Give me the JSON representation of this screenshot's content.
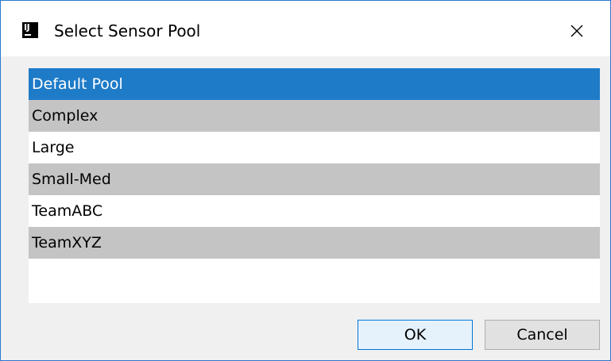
{
  "window": {
    "title": "Select Sensor Pool",
    "icon": "intellij-icon",
    "app_icon_text": "IJ"
  },
  "list": {
    "items": [
      {
        "label": "Default Pool",
        "selected": true
      },
      {
        "label": "Complex",
        "selected": false
      },
      {
        "label": "Large",
        "selected": false
      },
      {
        "label": "Small-Med",
        "selected": false
      },
      {
        "label": "TeamABC",
        "selected": false
      },
      {
        "label": "TeamXYZ",
        "selected": false
      }
    ]
  },
  "buttons": {
    "ok_label": "OK",
    "cancel_label": "Cancel"
  },
  "colors": {
    "selection": "#1e7bc8",
    "alternate_row": "#c4c4c4",
    "window_border": "#2b79d0"
  }
}
